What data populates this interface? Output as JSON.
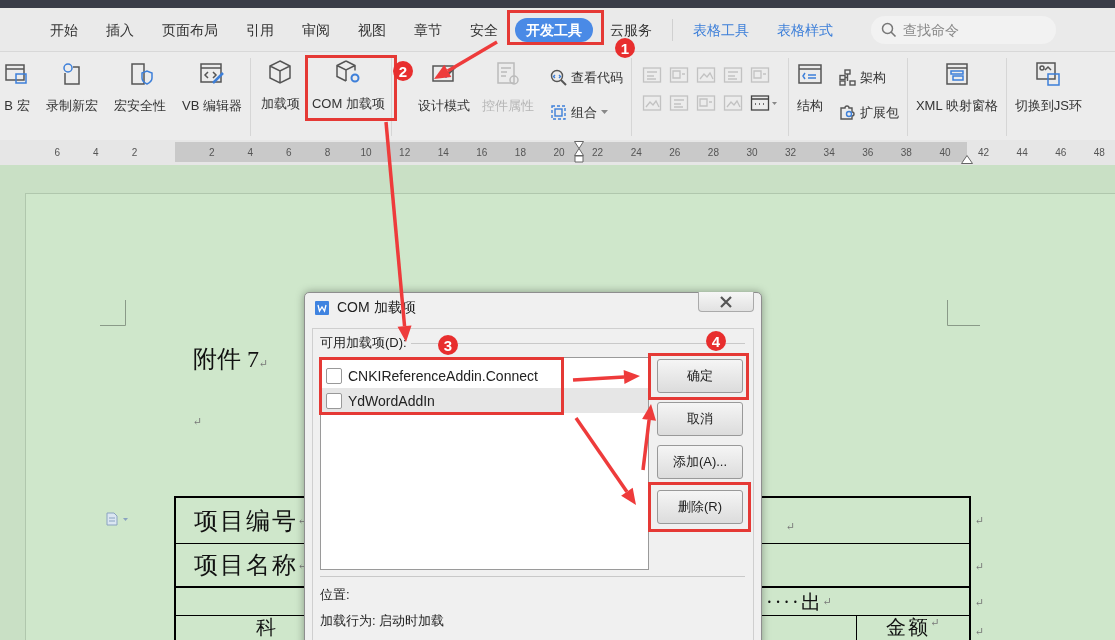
{
  "tabs": [
    {
      "label": "开始",
      "selected": false,
      "kind": "main"
    },
    {
      "label": "插入",
      "selected": false,
      "kind": "main"
    },
    {
      "label": "页面布局",
      "selected": false,
      "kind": "main"
    },
    {
      "label": "引用",
      "selected": false,
      "kind": "main"
    },
    {
      "label": "审阅",
      "selected": false,
      "kind": "main"
    },
    {
      "label": "视图",
      "selected": false,
      "kind": "main"
    },
    {
      "label": "章节",
      "selected": false,
      "kind": "main"
    },
    {
      "label": "安全",
      "selected": false,
      "kind": "main"
    },
    {
      "label": "开发工具",
      "selected": true,
      "kind": "main"
    },
    {
      "label": "云服务",
      "selected": false,
      "kind": "main"
    },
    {
      "label": "表格工具",
      "selected": false,
      "kind": "context"
    },
    {
      "label": "表格样式",
      "selected": false,
      "kind": "context"
    }
  ],
  "search": {
    "placeholder": "查找命令"
  },
  "ribbon": {
    "groups": [
      {
        "items": [
          {
            "kind": "large",
            "label": "B 宏",
            "disabled": false
          },
          {
            "kind": "large",
            "label": "录制新宏",
            "disabled": false
          },
          {
            "kind": "large",
            "label": "宏安全性",
            "disabled": false
          },
          {
            "kind": "large",
            "label": "VB 编辑器",
            "disabled": false
          }
        ]
      },
      {
        "items": [
          {
            "kind": "large",
            "label": "加载项",
            "disabled": false
          },
          {
            "kind": "large",
            "label": "COM 加载项",
            "disabled": false
          }
        ]
      },
      {
        "items": [
          {
            "kind": "large",
            "label": "设计模式",
            "disabled": false
          },
          {
            "kind": "large",
            "label": "控件属性",
            "disabled": true
          },
          {
            "kind": "stack",
            "items": [
              {
                "label": "查看代码",
                "dropdown": false
              },
              {
                "label": "组合",
                "dropdown": true
              }
            ]
          }
        ]
      },
      {
        "items": [
          {
            "kind": "control-grid",
            "disabled": true
          }
        ]
      },
      {
        "items": [
          {
            "kind": "large",
            "label": "结构",
            "disabled": false
          },
          {
            "kind": "stack",
            "items": [
              {
                "label": "架构",
                "dropdown": false
              },
              {
                "label": "扩展包",
                "dropdown": false
              }
            ]
          }
        ]
      },
      {
        "items": [
          {
            "kind": "large",
            "label": "XML 映射窗格",
            "disabled": false
          }
        ]
      },
      {
        "items": [
          {
            "kind": "large",
            "label": "切换到JS环",
            "disabled": false
          }
        ]
      }
    ]
  },
  "ruler": {
    "left_labels": [
      "6",
      "4",
      "2"
    ],
    "right_labels": [
      "2",
      "4",
      "6",
      "8",
      "10",
      "12",
      "14",
      "16",
      "18",
      "20",
      "22",
      "24",
      "26",
      "28",
      "30",
      "32",
      "34",
      "36",
      "38",
      "40",
      "42",
      "44",
      "46",
      "48"
    ]
  },
  "document": {
    "heading": {
      "text": "附件 7",
      "mark": "↵"
    },
    "blank_mark": "↵",
    "table": {
      "rows": [
        {
          "cells": [
            {
              "text": "项目编号",
              "mark": "↵"
            },
            {
              "mark": "↵"
            }
          ],
          "end_mark": "↵"
        },
        {
          "cells": [
            {
              "text": "项目名称",
              "mark": "↵"
            }
          ],
          "end_mark": "↵"
        },
        {
          "cells": [
            {
              "text": "····出",
              "mark": "↵"
            }
          ],
          "end_mark": "↵"
        },
        {
          "cells": [
            {
              "text": "科"
            },
            {
              "text": "金额",
              "mark": "↵"
            }
          ],
          "end_mark": "↵"
        }
      ]
    }
  },
  "dialog": {
    "title": "COM 加载项",
    "list_label": "可用加载项(D):",
    "addins": [
      {
        "name": "CNKIReferenceAddin.Connect",
        "checked": false,
        "selected": false
      },
      {
        "name": "YdWordAddIn",
        "checked": false,
        "selected": true
      }
    ],
    "buttons": [
      "确定",
      "取消",
      "添加(A)...",
      "删除(R)"
    ],
    "location": "位置:",
    "load_behavior": "加载行为: 启动时加载"
  },
  "annotations": [
    {
      "label": "1"
    },
    {
      "label": "2"
    },
    {
      "label": "3"
    },
    {
      "label": "4"
    }
  ]
}
